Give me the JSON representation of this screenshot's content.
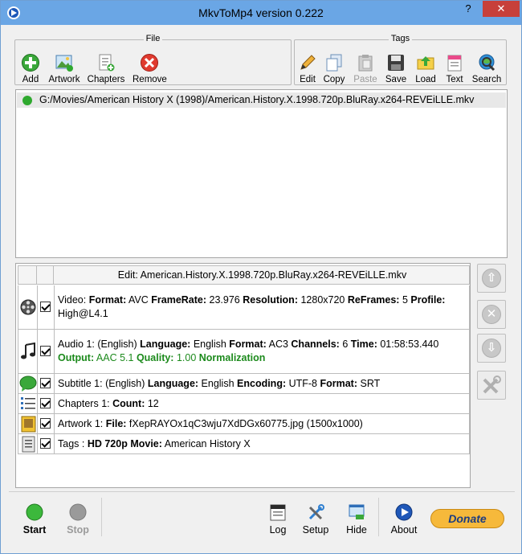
{
  "window": {
    "title": "MkvToMp4 version 0.222",
    "help": "?",
    "close": "✕"
  },
  "file_group": {
    "title": "File",
    "tools": [
      {
        "label": "Add",
        "icon": "add-icon"
      },
      {
        "label": "Artwork",
        "icon": "artwork-icon"
      },
      {
        "label": "Chapters",
        "icon": "chapters-icon"
      },
      {
        "label": "Remove",
        "icon": "remove-icon"
      }
    ]
  },
  "tags_group": {
    "title": "Tags",
    "tools": [
      {
        "label": "Edit",
        "icon": "pencil-icon"
      },
      {
        "label": "Copy",
        "icon": "copy-icon"
      },
      {
        "label": "Paste",
        "icon": "paste-icon",
        "disabled": true
      },
      {
        "label": "Save",
        "icon": "save-icon"
      },
      {
        "label": "Load",
        "icon": "load-icon"
      },
      {
        "label": "Text",
        "icon": "text-icon"
      },
      {
        "label": "Search",
        "icon": "search-icon"
      }
    ]
  },
  "file_list": {
    "items": [
      {
        "path": "G:/Movies/American History X (1998)/American.History.X.1998.720p.BluRay.x264-REVEiLLE.mkv",
        "status_color": "#2fa92f"
      }
    ]
  },
  "edit_table": {
    "title": "Edit: American.History.X.1998.720p.BluRay.x264-REVEiLLE.mkv",
    "rows": {
      "video": {
        "prefix": "Video: ",
        "format_label": "Format:",
        "format": " AVC ",
        "framerate_label": "FrameRate:",
        "framerate": " 23.976 ",
        "resolution_label": "Resolution:",
        "resolution": " 1280x720 ",
        "reframes_label": "ReFrames:",
        "reframes": " 5 ",
        "profile_label": "Profile:",
        "profile": "High@L4.1"
      },
      "audio": {
        "prefix": "Audio 1: (English) ",
        "language_label": "Language:",
        "language": " English ",
        "format_label": "Format:",
        "format": " AC3 ",
        "channels_label": "Channels:",
        "channels": " 6 ",
        "time_label": "Time:",
        "time": " 01:58:53.440",
        "output_label": "Output:",
        "output": " AAC 5.1 ",
        "quality_label": "Quality:",
        "quality": " 1.00 ",
        "normalization_label": "Normalization"
      },
      "subtitle": {
        "prefix": "Subtitle 1: (English) ",
        "language_label": "Language:",
        "language": " English ",
        "encoding_label": "Encoding:",
        "encoding": " UTF-8 ",
        "format_label": "Format:",
        "format": " SRT"
      },
      "chapters": {
        "prefix": "Chapters 1: ",
        "count_label": "Count:",
        "count": " 12"
      },
      "artwork": {
        "prefix": "Artwork 1: ",
        "file_label": "File:",
        "file": " fXepRAYOx1qC3wju7XdDGx60775.jpg (1500x1000)"
      },
      "tags": {
        "prefix": "Tags : ",
        "hd_label": "HD 720p Movie:",
        "movie": " American History X"
      }
    }
  },
  "side_buttons": [
    {
      "icon": "arrow-up-icon",
      "glyph": "⇧"
    },
    {
      "icon": "delete-icon",
      "glyph": "✕"
    },
    {
      "icon": "arrow-down-icon",
      "glyph": "⇩"
    },
    {
      "icon": "tools-icon",
      "glyph": "✗"
    }
  ],
  "bottom": {
    "start": "Start",
    "stop": "Stop",
    "log": "Log",
    "setup": "Setup",
    "hide": "Hide",
    "about": "About",
    "donate": "Donate"
  },
  "colors": {
    "accent_green": "#2fa92f",
    "output_green": "#1c8a1c",
    "titlebar": "#6aa6e5",
    "close": "#c7403a"
  }
}
